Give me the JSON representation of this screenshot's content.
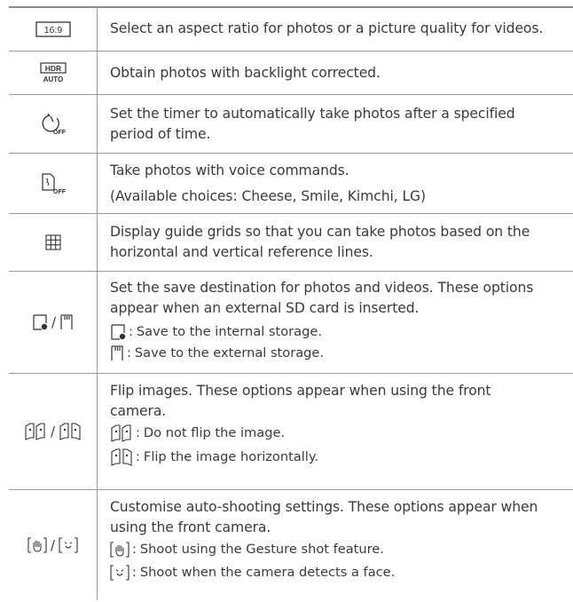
{
  "rows": [
    {
      "icon": "aspect-ratio-icon",
      "icon_label": "16:9",
      "text": "Select an aspect ratio for photos or a picture quality for videos."
    },
    {
      "icon": "hdr-auto-icon",
      "icon_label_top": "HDR",
      "icon_label_bottom": "AUTO",
      "text": "Obtain photos with backlight corrected."
    },
    {
      "icon": "timer-off-icon",
      "icon_label": "OFF",
      "lines": [
        "Set the timer to automatically take photos after a specified",
        "period of time."
      ]
    },
    {
      "icon": "voice-shutter-off-icon",
      "icon_label": "OFF",
      "text": "Take photos with voice commands.",
      "note": "(Available choices: Cheese, Smile, Kimchi, LG)"
    },
    {
      "icon": "grid-icon",
      "lines": [
        "Display guide grids so that you can take photos based on the",
        "horizontal and vertical reference lines."
      ]
    },
    {
      "icons": [
        "internal-storage-icon",
        "sd-card-icon"
      ],
      "lines": [
        "Set the save destination for photos and videos. These options",
        "appear when an external SD card is inserted."
      ],
      "items": [
        {
          "icon": "internal-storage-icon",
          "text": "Save to the internal storage."
        },
        {
          "icon": "sd-card-icon",
          "text": "Save to the external storage."
        }
      ]
    },
    {
      "icons": [
        "flip-off-icon",
        "flip-horizontal-icon"
      ],
      "lines": [
        "Flip images. These options appear when using the front",
        "camera."
      ],
      "items": [
        {
          "icon": "flip-off-icon",
          "text": "Do not flip the image."
        },
        {
          "icon": "flip-horizontal-icon",
          "text": "Flip the image horizontally."
        }
      ]
    },
    {
      "icons": [
        "gesture-shot-icon",
        "face-detect-icon"
      ],
      "lines": [
        "Customise auto-shooting settings. These options appear when",
        "using the front camera."
      ],
      "items": [
        {
          "icon": "gesture-shot-icon",
          "text": "Shoot using the Gesture shot feature."
        },
        {
          "icon": "face-detect-icon",
          "text": "Shoot when the camera detects a face."
        }
      ]
    }
  ],
  "separator": "/",
  "colon": ":"
}
